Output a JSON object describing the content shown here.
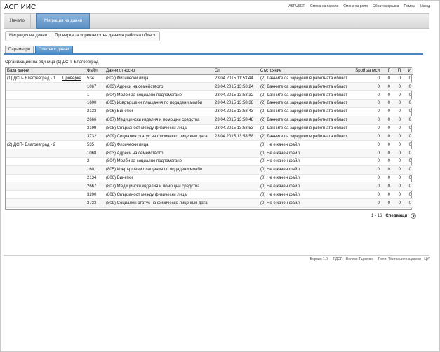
{
  "app": {
    "title": "АСП ИИС"
  },
  "top_links": [
    "ASPUSER",
    "Смяна на парола",
    "Смяна на роля",
    "Обратна връзка",
    "Помощ",
    "Изход"
  ],
  "nav": {
    "home": "Начало",
    "active": "Миграция на данни"
  },
  "breadcrumb": {
    "first": "Миграция на данни",
    "current": "Проверка за коректност на данни в работна област"
  },
  "tabs": {
    "params": "Параметри",
    "list": "Списък с данни"
  },
  "org_label": "Организационна единица (1) ДСП- Благоевград",
  "table": {
    "columns": [
      "База данни",
      "Файл",
      "Данни относно",
      "От",
      "Състояние",
      "Брой записи",
      "Г",
      "П",
      "И"
    ],
    "rows": [
      {
        "db": "(1) ДСП- Благоевград - 1",
        "link": "Проверка",
        "file": "534",
        "about": "(802) Физически лица",
        "from": "23.04.2015 11:53:44",
        "state": "(2) Данните са заредени в работната област",
        "count": "0",
        "g": "0",
        "p": "0",
        "i": "0"
      },
      {
        "db": "",
        "link": "",
        "file": "1067",
        "about": "(803) Адреси на семейството",
        "from": "23.04.2015 13:58:24",
        "state": "(2) Данните са заредени в работната област",
        "count": "0",
        "g": "0",
        "p": "0",
        "i": "0"
      },
      {
        "db": "",
        "link": "",
        "file": "1",
        "about": "(804) Молби за социално подпомагане",
        "from": "23.04.2015 13:58:32",
        "state": "(2) Данните са заредени в работната област",
        "count": "0",
        "g": "0",
        "p": "0",
        "i": "0"
      },
      {
        "db": "",
        "link": "",
        "file": "1600",
        "about": "(805) Изврършени плащания по подадени молби",
        "from": "23.04.2015 13:58:38",
        "state": "(2) Данните са заредени в работната област",
        "count": "0",
        "g": "0",
        "p": "0",
        "i": "0"
      },
      {
        "db": "",
        "link": "",
        "file": "2133",
        "about": "(806) Винетки",
        "from": "23.04.2015 13:58:43",
        "state": "(2) Данните са заредени в работната област",
        "count": "0",
        "g": "0",
        "p": "0",
        "i": "0"
      },
      {
        "db": "",
        "link": "",
        "file": "2666",
        "about": "(807) Медицински изделия и помощни средства",
        "from": "23.04.2015 13:58:48",
        "state": "(2) Данните са заредени в работната област",
        "count": "0",
        "g": "0",
        "p": "0",
        "i": "0"
      },
      {
        "db": "",
        "link": "",
        "file": "3199",
        "about": "(808) Свързаност между физически лица",
        "from": "23.04.2015 13:58:53",
        "state": "(2) Данните са заредени в работната област",
        "count": "0",
        "g": "0",
        "p": "0",
        "i": "0"
      },
      {
        "db": "",
        "link": "",
        "file": "3732",
        "about": "(809) Социален статус на физическо лице към дата",
        "from": "23.04.2015 13:58:58",
        "state": "(2) Данните са заредени в работната област",
        "count": "0",
        "g": "0",
        "p": "0",
        "i": "0"
      },
      {
        "db": "(2) ДСП- Благоевград - 2",
        "link": "",
        "file": "535",
        "about": "(802) Физически лица",
        "from": "",
        "state": "(0) Не е качен файл",
        "count": "0",
        "g": "0",
        "p": "0",
        "i": "0"
      },
      {
        "db": "",
        "link": "",
        "file": "1068",
        "about": "(803) Адреси на семейството",
        "from": "",
        "state": "(0) Не е качен файл",
        "count": "0",
        "g": "0",
        "p": "0",
        "i": "0"
      },
      {
        "db": "",
        "link": "",
        "file": "2",
        "about": "(804) Молби за социално подпомагане",
        "from": "",
        "state": "(0) Не е качен файл",
        "count": "0",
        "g": "0",
        "p": "0",
        "i": "0"
      },
      {
        "db": "",
        "link": "",
        "file": "1601",
        "about": "(805) Изврършени плащания по подадени молби",
        "from": "",
        "state": "(0) Не е качен файл",
        "count": "0",
        "g": "0",
        "p": "0",
        "i": "0"
      },
      {
        "db": "",
        "link": "",
        "file": "2134",
        "about": "(806) Винетки",
        "from": "",
        "state": "(0) Не е качен файл",
        "count": "0",
        "g": "0",
        "p": "0",
        "i": "0"
      },
      {
        "db": "",
        "link": "",
        "file": "2667",
        "about": "(807) Медицински изделия и помощни средства",
        "from": "",
        "state": "(0) Не е качен файл",
        "count": "0",
        "g": "0",
        "p": "0",
        "i": "0"
      },
      {
        "db": "",
        "link": "",
        "file": "3200",
        "about": "(808) Свързаност между физически лица",
        "from": "",
        "state": "(0) Не е качен файл",
        "count": "0",
        "g": "0",
        "p": "0",
        "i": "0"
      },
      {
        "db": "",
        "link": "",
        "file": "3733",
        "about": "(809) Социален статус на физическо лице към дата",
        "from": "",
        "state": "(0) Не е качен файл",
        "count": "0",
        "g": "0",
        "p": "0",
        "i": "0"
      }
    ]
  },
  "pager": {
    "range": "1 - 16",
    "next": "Следващи",
    "next_icon": "chevron-right-icon"
  },
  "footer": {
    "version": "Версия 1.0",
    "org": "РДСП - Велико Търново",
    "role": "Роля: \"Миграция на данни - ЦУ\""
  },
  "colors": {
    "accent": "#4a87c0",
    "active_tab": "#5b8fc4"
  }
}
